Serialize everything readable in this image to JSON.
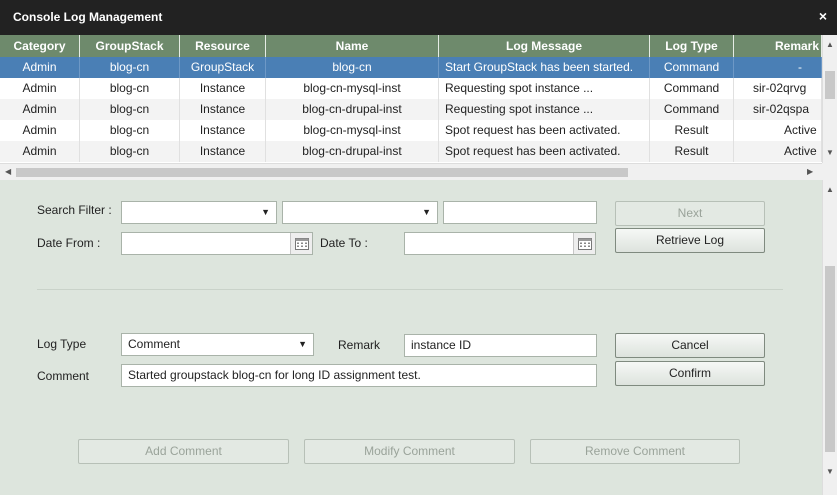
{
  "window": {
    "title": "Console Log Management",
    "close_glyph": "×"
  },
  "grid": {
    "columns": [
      "Category",
      "GroupStack",
      "Resource",
      "Name",
      "Log Message",
      "Log Type",
      "Remark"
    ],
    "rows": [
      [
        "Admin",
        "blog-cn",
        "GroupStack",
        "blog-cn",
        "Start GroupStack has been started.",
        "Command",
        "-"
      ],
      [
        "Admin",
        "blog-cn",
        "Instance",
        "blog-cn-mysql-inst",
        "Requesting spot instance ...",
        "Command",
        "sir-02qrvg"
      ],
      [
        "Admin",
        "blog-cn",
        "Instance",
        "blog-cn-drupal-inst",
        "Requesting spot instance ...",
        "Command",
        "sir-02qspa"
      ],
      [
        "Admin",
        "blog-cn",
        "Instance",
        "blog-cn-mysql-inst",
        "Spot request has been activated.",
        "Result",
        "Active"
      ],
      [
        "Admin",
        "blog-cn",
        "Instance",
        "blog-cn-drupal-inst",
        "Spot request has been activated.",
        "Result",
        "Active"
      ]
    ]
  },
  "search": {
    "label": "Search Filter :",
    "filter1": "",
    "filter2": "",
    "text": "",
    "date_from_label": "Date From :",
    "date_from": "",
    "date_to_label": "Date To :",
    "date_to": "",
    "next_label": "Next",
    "retrieve_label": "Retrieve Log"
  },
  "edit": {
    "log_type_label": "Log Type",
    "log_type_value": "Comment",
    "remark_label": "Remark",
    "remark_value": "instance ID",
    "comment_label": "Comment",
    "comment_value": "Started groupstack blog-cn for long ID assignment test.",
    "cancel_label": "Cancel",
    "confirm_label": "Confirm"
  },
  "actions": {
    "add_label": "Add Comment",
    "modify_label": "Modify Comment",
    "remove_label": "Remove Comment"
  },
  "icons": [
    "close-icon",
    "calendar-icon",
    "dropdown-caret-icon",
    "scroll-arrow-icon"
  ],
  "colors": {
    "header": "#6e8a6c",
    "selected_row": "#4a7fb5",
    "panel": "#dde5dd",
    "titlebar": "#222222"
  }
}
